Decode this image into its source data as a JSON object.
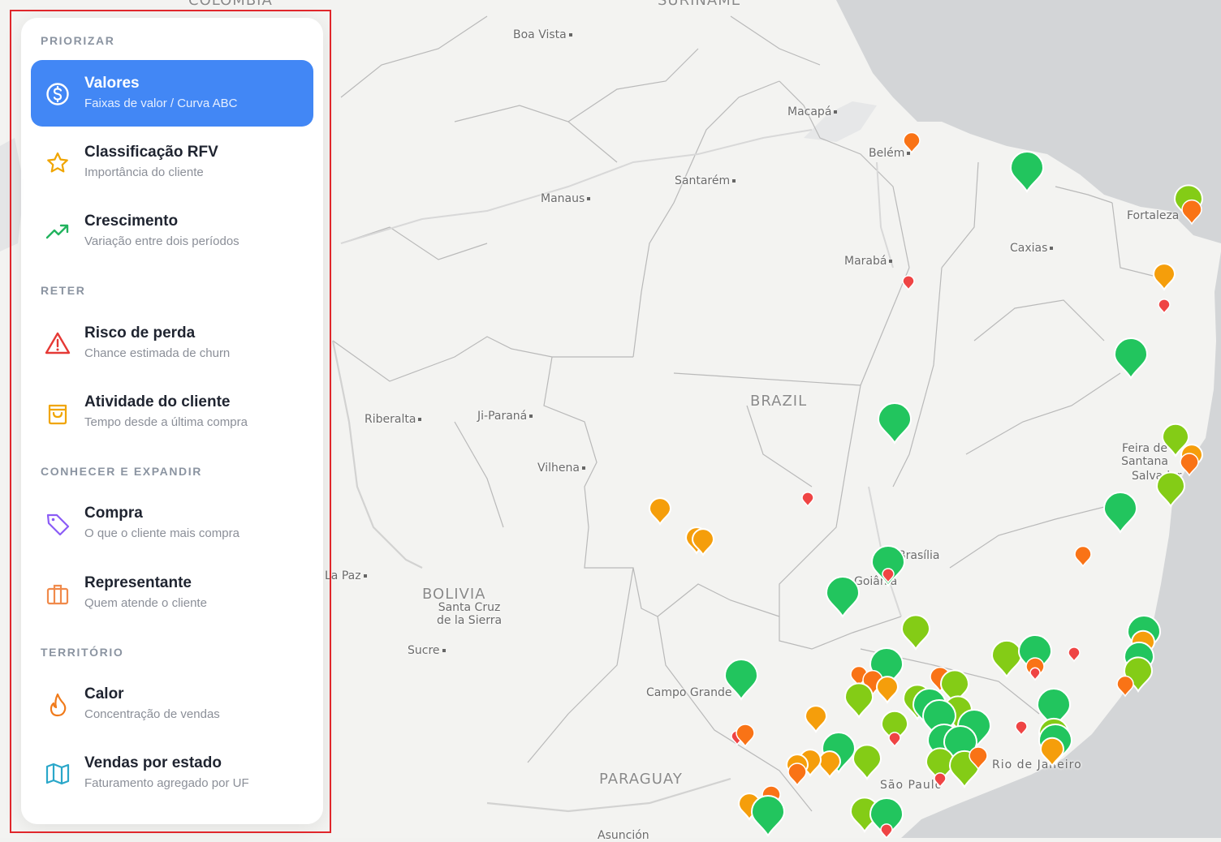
{
  "sidebar": {
    "sections": [
      {
        "title": "PRIORIZAR"
      },
      {
        "title": "RETER"
      },
      {
        "title": "CONHECER E EXPANDIR"
      },
      {
        "title": "TERRITÓRIO"
      }
    ],
    "items": [
      {
        "title": "Valores",
        "subtitle": "Faixas de valor / Curva ABC",
        "icon": "dollar-circle-icon",
        "active": true
      },
      {
        "title": "Classificação RFV",
        "subtitle": "Importância do cliente",
        "icon": "star-icon"
      },
      {
        "title": "Crescimento",
        "subtitle": "Variação entre dois períodos",
        "icon": "trending-up-icon"
      },
      {
        "title": "Risco de perda",
        "subtitle": "Chance estimada de churn",
        "icon": "warning-icon"
      },
      {
        "title": "Atividade do cliente",
        "subtitle": "Tempo desde a última compra",
        "icon": "shopping-bag-icon"
      },
      {
        "title": "Compra",
        "subtitle": "O que o cliente mais compra",
        "icon": "tag-icon"
      },
      {
        "title": "Representante",
        "subtitle": "Quem atende o cliente",
        "icon": "briefcase-icon"
      },
      {
        "title": "Calor",
        "subtitle": "Concentração de vendas",
        "icon": "flame-icon"
      },
      {
        "title": "Vendas por estado",
        "subtitle": "Faturamento agregado por UF",
        "icon": "map-icon"
      }
    ]
  },
  "map": {
    "countries": [
      "COLOMBIA",
      "SURINAME",
      "BRAZIL",
      "BOLIVIA",
      "PARAGUAY"
    ],
    "cities": [
      "Boa Vista",
      "Macapá",
      "Belém",
      "Santarém",
      "Manaus",
      "Fortaleza",
      "Caxias",
      "Marabá",
      "Ji-Paraná",
      "Riberalta",
      "Vilhena",
      "Feira de Santana",
      "Salvador",
      "Brasília",
      "Goiânia",
      "La Paz",
      "Santa Cruz de la Sierra",
      "Sucre",
      "Campo Grande",
      "São Paulo",
      "Rio de Janeiro",
      "Asunción"
    ],
    "colors": {
      "green": "#22c55e",
      "lime": "#84cc16",
      "yellow": "#f59e0b",
      "orange": "#f97316",
      "red": "#ef4444"
    }
  }
}
